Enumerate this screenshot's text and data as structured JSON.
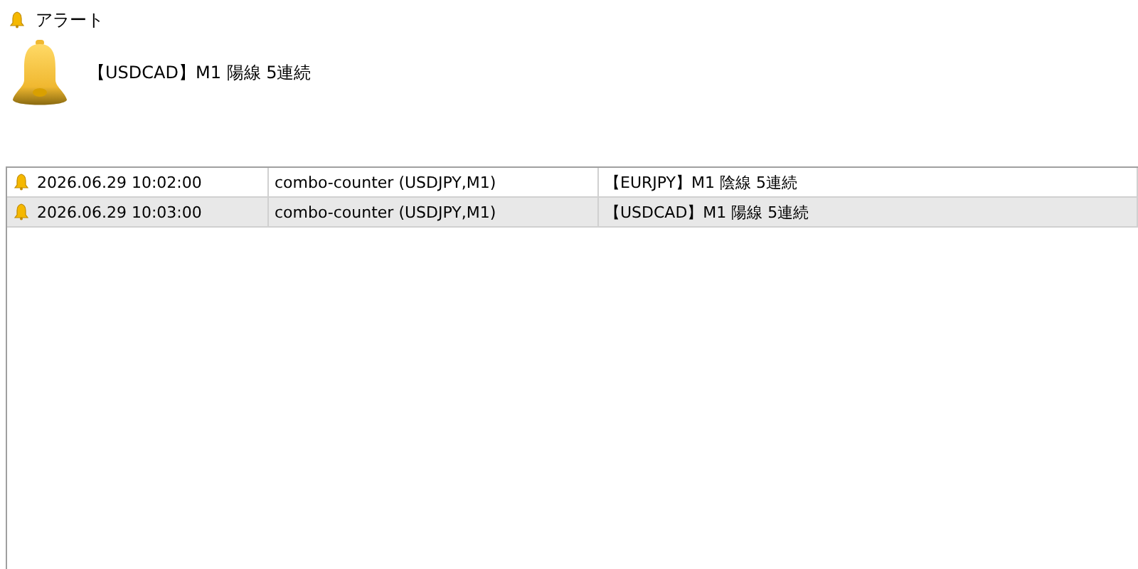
{
  "window": {
    "title": "アラート"
  },
  "current_alert": {
    "message": "【USDCAD】M1 陽線 5連続"
  },
  "alerts": [
    {
      "time": "2026.06.29 10:02:00",
      "source": "combo-counter (USDJPY,M1)",
      "message": "【EURJPY】M1 陰線 5連続",
      "selected": false
    },
    {
      "time": "2026.06.29 10:03:00",
      "source": "combo-counter (USDJPY,M1)",
      "message": "【USDCAD】M1 陽線 5連続",
      "selected": true
    }
  ]
}
